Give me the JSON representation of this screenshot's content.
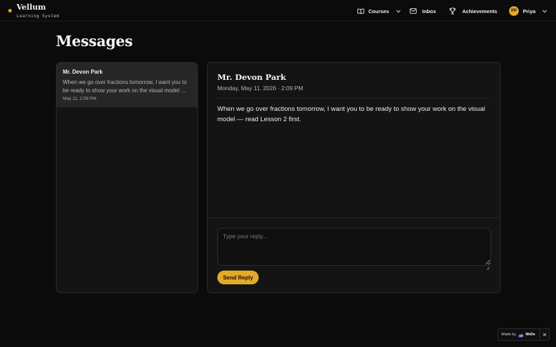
{
  "app": {
    "name": "Vellum",
    "subtitle": "Learning System",
    "accent_color": "#e3a92b"
  },
  "nav": {
    "courses": {
      "label": "Courses",
      "icon": "book-icon"
    },
    "inbox": {
      "label": "Inbox",
      "icon": "mail-icon"
    },
    "achievements": {
      "label": "Achievements",
      "icon": "trophy-icon"
    },
    "user": {
      "initials": "PP",
      "name": "Priya"
    }
  },
  "page": {
    "title": "Messages"
  },
  "messages": [
    {
      "sender": "Mr. Devon Park",
      "preview": "When we go over fractions tomorrow, I want you to be ready to show your work on the visual model — read Lesson 2 first.",
      "date": "May 11, 2:09 PM",
      "selected": true
    }
  ],
  "detail": {
    "sender": "Mr. Devon Park",
    "date": "Monday, May 11, 2026 · 2:09 PM",
    "body": "When we go over fractions tomorrow, I want you to be ready to show your work on the visual model — read Lesson 2 first."
  },
  "reply": {
    "placeholder": "Type your reply...",
    "send_label": "Send Reply"
  },
  "badge": {
    "label": "Made by",
    "brand": "MeDo",
    "close": "✕"
  }
}
